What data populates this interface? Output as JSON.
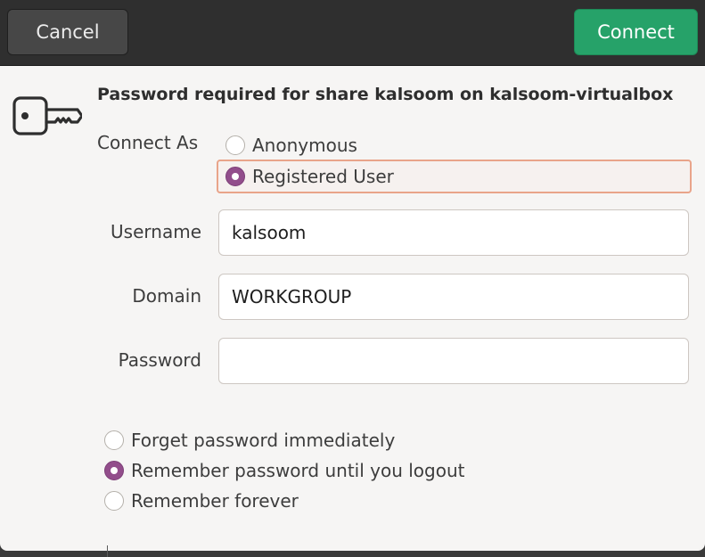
{
  "header": {
    "cancel_label": "Cancel",
    "connect_label": "Connect",
    "connect_color": "#26a269"
  },
  "dialog": {
    "icon": "key-icon",
    "title": "Password required for share kalsoom on kalsoom-virtualbox",
    "connect_as": {
      "label": "Connect As",
      "options": [
        {
          "label": "Anonymous",
          "checked": false
        },
        {
          "label": "Registered User",
          "checked": true
        }
      ]
    },
    "fields": {
      "username": {
        "label": "Username",
        "value": "kalsoom"
      },
      "domain": {
        "label": "Domain",
        "value": "WORKGROUP"
      },
      "password": {
        "label": "Password",
        "value": ""
      }
    },
    "remember": {
      "options": [
        {
          "label": "Forget password immediately",
          "checked": false
        },
        {
          "label": "Remember password until you logout",
          "checked": true
        },
        {
          "label": "Remember forever",
          "checked": false
        }
      ]
    }
  },
  "accent_color": "#924d8b"
}
